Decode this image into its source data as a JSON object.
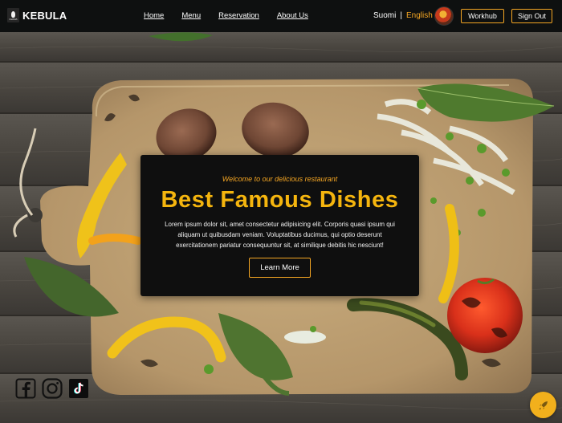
{
  "brand": {
    "name": "KEBULA",
    "logo_text": "KEBAB"
  },
  "nav": {
    "links": [
      "Home",
      "Menu",
      "Reservation",
      "About Us"
    ]
  },
  "language": {
    "option_1": "Suomi",
    "separator": "|",
    "option_2": "English",
    "active": "English"
  },
  "header_buttons": {
    "workhub": "Workhub",
    "signout": "Sign Out"
  },
  "hero": {
    "subtitle": "Welcome to our delicious restaurant",
    "title": "Best Famous Dishes",
    "description": "Lorem ipsum dolor sit, amet consectetur adipisicing elit. Corporis quasi ipsum qui aliquam ut quibusdam veniam. Voluptatibus ducimus, qui optio deserunt exercitationem pariatur consequuntur sit, at similique debitis hic nesciunt!",
    "button": "Learn More"
  },
  "social": [
    "facebook-icon",
    "instagram-icon",
    "tiktok-icon"
  ],
  "colors": {
    "accent": "#f5a623",
    "title": "#f5b50e",
    "navbar": "#0e1010",
    "card": "#0f0f0f",
    "fab": "#f2b01c"
  }
}
